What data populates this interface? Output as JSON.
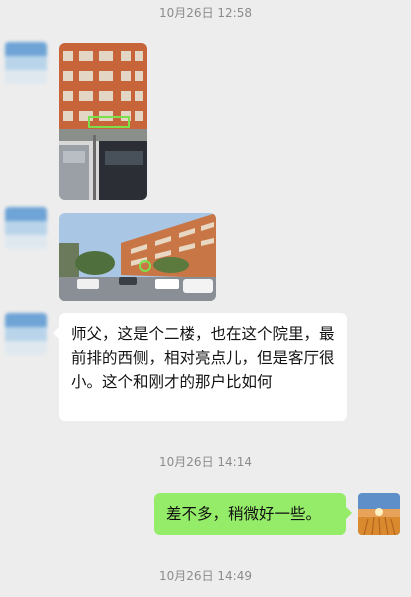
{
  "timestamps": [
    "10月26日 12:58",
    "10月26日 14:14",
    "10月26日 14:49"
  ],
  "messages": {
    "incoming_text": "师父，这是个二楼，也在这个院里，最前排的西侧，相对亮点儿，但是客厅很小。这个和刚才的那户比如何",
    "outgoing_text": "差不多，稍微好一些。"
  },
  "colors": {
    "background": "#ededed",
    "outgoing_bubble": "#95ec69",
    "incoming_bubble": "#ffffff",
    "timestamp_text": "#8c8c8c"
  }
}
